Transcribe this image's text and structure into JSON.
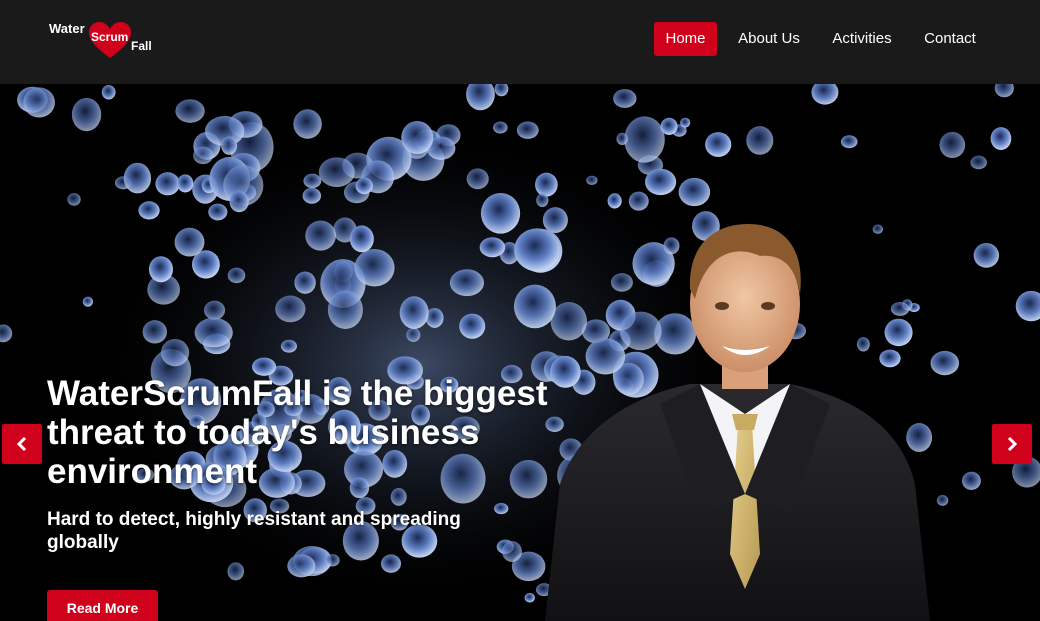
{
  "logo": {
    "word_water": "Water",
    "word_scrum": "Scrum",
    "word_fall": "Fall"
  },
  "nav": {
    "items": [
      {
        "label": "Home",
        "active": true
      },
      {
        "label": "About Us",
        "active": false
      },
      {
        "label": "Activities",
        "active": false
      },
      {
        "label": "Contact",
        "active": false
      }
    ]
  },
  "hero": {
    "headline": "WaterScrumFall is the biggest threat to today's business environment",
    "subheadline": "Hard to detect, highly resistant and spreading globally",
    "cta_label": "Read More",
    "prev_icon": "chevron-left-icon",
    "next_icon": "chevron-right-icon"
  },
  "colors": {
    "accent": "#d0021b",
    "header_bg": "#1a1a1a"
  }
}
